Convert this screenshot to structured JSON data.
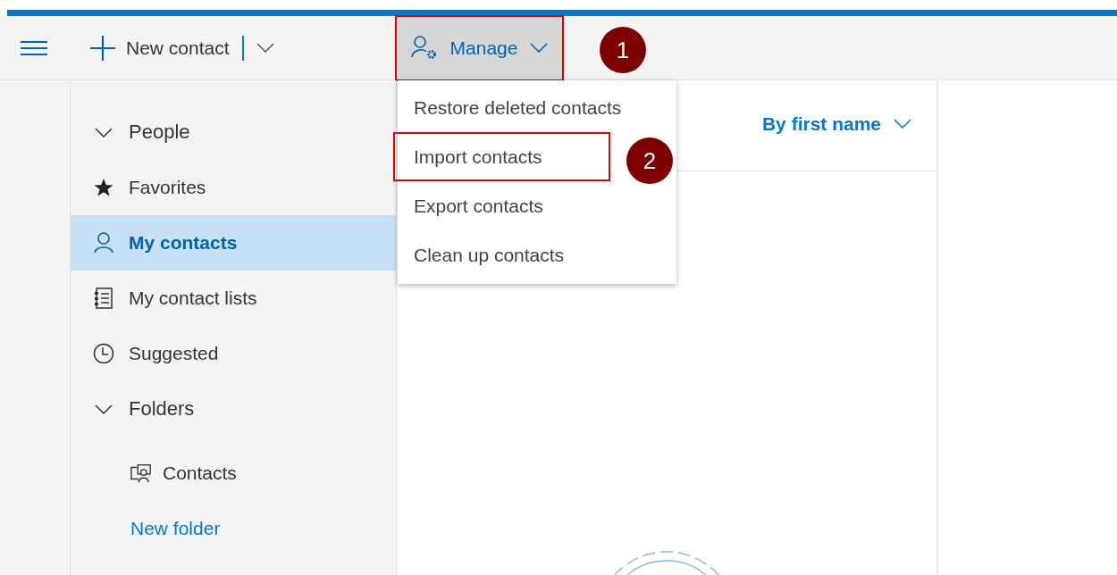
{
  "toolbar": {
    "new_contact": "New contact",
    "manage": {
      "label": "Manage",
      "expanded": true,
      "highlighted": true
    }
  },
  "manage_menu": [
    {
      "label": "Restore deleted contacts",
      "highlighted": false
    },
    {
      "label": "Import contacts",
      "highlighted": true
    },
    {
      "label": "Export contacts",
      "highlighted": false
    },
    {
      "label": "Clean up contacts",
      "highlighted": false
    }
  ],
  "sidebar": {
    "groups": [
      {
        "label": "People",
        "expanded": true,
        "children": [
          {
            "label": "Favorites",
            "selected": false
          },
          {
            "label": "My contacts",
            "selected": true
          },
          {
            "label": "My contact lists",
            "selected": false
          },
          {
            "label": "Suggested",
            "selected": false
          }
        ]
      },
      {
        "label": "Folders",
        "expanded": true,
        "children": [
          {
            "label": "Contacts",
            "selected": false
          }
        ],
        "link": "New folder"
      }
    ]
  },
  "list": {
    "sort": "By first name"
  },
  "annotations": [
    {
      "label": "1"
    },
    {
      "label": "2"
    }
  ]
}
